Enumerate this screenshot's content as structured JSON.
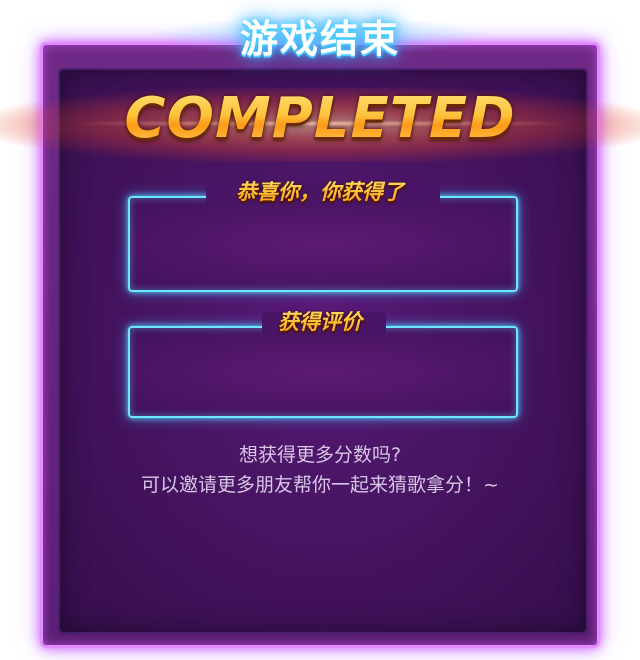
{
  "header": {
    "title": "游戏结束"
  },
  "result": {
    "status_text": "COMPLETED"
  },
  "reward_section": {
    "label": "恭喜你，你获得了"
  },
  "rating_section": {
    "label": "获得评价"
  },
  "prompt": {
    "line1": "想获得更多分数吗?",
    "line2": "可以邀请更多朋友帮你一起来猜歌拿分！~"
  },
  "colors": {
    "neon_frame": "#e48bff",
    "neon_box": "#6fe6ff",
    "title_glow": "#34b6ff",
    "gold": "#ffc23a",
    "panel": "#44135e"
  }
}
